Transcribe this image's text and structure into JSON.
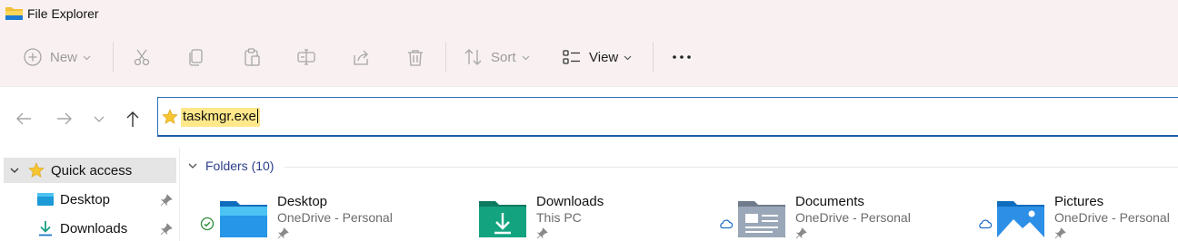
{
  "window": {
    "title": "File Explorer"
  },
  "toolbar": {
    "new_label": "New",
    "sort_label": "Sort",
    "view_label": "View"
  },
  "address": {
    "value": "taskmgr.exe"
  },
  "sidebar": {
    "items": [
      {
        "label": "Quick access"
      },
      {
        "label": "Desktop"
      },
      {
        "label": "Downloads"
      }
    ]
  },
  "content": {
    "section_title": "Folders (10)",
    "folders": [
      {
        "name": "Desktop",
        "location": "OneDrive - Personal",
        "status": "synced-check"
      },
      {
        "name": "Downloads",
        "location": "This PC",
        "status": "none"
      },
      {
        "name": "Documents",
        "location": "OneDrive - Personal",
        "status": "cloud"
      },
      {
        "name": "Pictures",
        "location": "OneDrive - Personal",
        "status": "cloud"
      }
    ]
  },
  "colors": {
    "accent": "#1f5ea8",
    "titlebar_bg": "#f9f1f1",
    "highlight": "#ffe88a",
    "sync_green": "#2e8b3a",
    "cloud_blue": "#1f6fc5"
  }
}
